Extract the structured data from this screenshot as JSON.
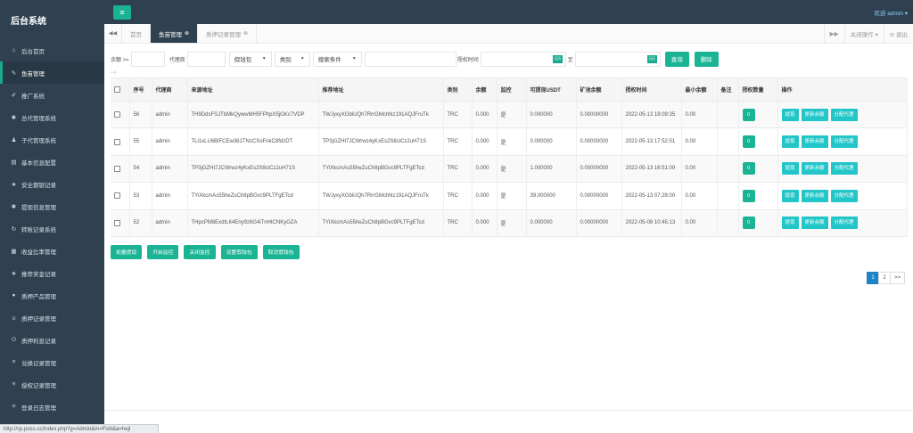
{
  "sidebar": {
    "brand": "后台系统",
    "items": [
      {
        "label": "后台首页",
        "icon": "home-icon",
        "glyph": "⌂"
      },
      {
        "label": "鱼苗管理",
        "icon": "wrench-icon",
        "glyph": "✎",
        "active": true
      },
      {
        "label": "推广系统",
        "icon": "edit-icon",
        "glyph": "✐"
      },
      {
        "label": "总代管理系统",
        "icon": "gear-icon",
        "glyph": "✱"
      },
      {
        "label": "子代管理系统",
        "icon": "users-icon",
        "glyph": "♟"
      },
      {
        "label": "基本信息配置",
        "icon": "document-icon",
        "glyph": "▤"
      },
      {
        "label": "安全期银记录",
        "icon": "star-icon",
        "glyph": "★"
      },
      {
        "label": "提现信息管理",
        "icon": "gear-icon",
        "glyph": "✱"
      },
      {
        "label": "转账记录系统",
        "icon": "refresh-icon",
        "glyph": "↻"
      },
      {
        "label": "收益比率管理",
        "icon": "calendar-icon",
        "glyph": "▦"
      },
      {
        "label": "推荐奖金记录",
        "icon": "star-icon",
        "glyph": "★"
      },
      {
        "label": "质押产品管理",
        "icon": "comment-icon",
        "glyph": "●"
      },
      {
        "label": "质押记录管理",
        "icon": "magnet-icon",
        "glyph": "∪"
      },
      {
        "label": "质押利息记录",
        "icon": "power-icon",
        "glyph": "⏻"
      },
      {
        "label": "兑换记录管理",
        "icon": "list-icon",
        "glyph": "≡"
      },
      {
        "label": "授权记录管理",
        "icon": "list-icon",
        "glyph": "≡"
      },
      {
        "label": "登录日志管理",
        "icon": "list-icon",
        "glyph": "≡"
      }
    ]
  },
  "status_url": "http://cp.poss.cc/index.php?g=Admin&m=Fish&a=heji",
  "topbar": {
    "menu_glyph": "≡",
    "welcome": "欢迎 admin ▾"
  },
  "tabs": {
    "left_arrow": "◀◀",
    "items": [
      {
        "label": "首页",
        "active": false,
        "close": ""
      },
      {
        "label": "鱼苗管理",
        "active": true,
        "close": "⊗"
      },
      {
        "label": "质押记录管理",
        "active": false,
        "close": "⊗"
      }
    ],
    "right_arrow": "▶▶",
    "close_ops": "关闭操作 ▾",
    "logout": "⊖ 退出"
  },
  "filters": {
    "balance_label": "余额 >=",
    "agent_label": "代理商",
    "wallet_select": "假钱包",
    "type_select": "类别",
    "search_select": "搜索条件",
    "auth_time_label": "授权时间",
    "to_label": "至",
    "date_icon": "日历",
    "query_button": "查询",
    "delete_button": "删除"
  },
  "comment_marker": "-->",
  "table": {
    "headers": [
      "",
      "序号",
      "代理商",
      "来源地址",
      "推荐地址",
      "类别",
      "余额",
      "监控",
      "可提现USDT",
      "矿池余额",
      "授权时间",
      "最小余额",
      "备注",
      "授权数量",
      "操作"
    ],
    "rows": [
      {
        "id": "56",
        "agent": "admin",
        "source": "TH9DdsFSJTbMkQywwMH5FPhpX5jGKc7VDP",
        "referrer": "TWJyxyXGbiUQh7RrrGMchNz191AQJFruTk",
        "type": "TRC",
        "balance": "0.000",
        "monitor": "是",
        "withdrawable": "0.000000",
        "pool": "0.00000000",
        "auth_time": "2022-05-13 18:09:35",
        "min_balance": "0.00",
        "note": "",
        "auth_count": "0"
      },
      {
        "id": "55",
        "agent": "admin",
        "source": "TLi1xLU6BiFCEw361TNzCSoFnkC8fdzDT",
        "referrer": "TP3jGZHt7JCWrwz4yKxEs2S8ciCz2uH71S",
        "type": "TRC",
        "balance": "0.000",
        "monitor": "是",
        "withdrawable": "0.000000",
        "pool": "0.00000000",
        "auth_time": "2022-05-13 17:52:51",
        "min_balance": "0.00",
        "note": "",
        "auth_count": "0"
      },
      {
        "id": "54",
        "agent": "admin",
        "source": "TP3jGZHt7JCWrwz4yKxEs2S8ciCz2uH71S",
        "referrer": "TYiXkcmAs55heZuCh8pBGvc9PLTFgETcd",
        "type": "TRC",
        "balance": "0.000",
        "monitor": "是",
        "withdrawable": "1.000000",
        "pool": "0.00000000",
        "auth_time": "2022-05-13 16:51:00",
        "min_balance": "0.00",
        "note": "",
        "auth_count": "0"
      },
      {
        "id": "53",
        "agent": "admin",
        "source": "TYiXkcmAs55heZuCh8pBGvc9PLTFgETcd",
        "referrer": "TWJyxyXGbiUQh7RrrGMchNz191AQJFruTk",
        "type": "TRC",
        "balance": "0.000",
        "monitor": "是",
        "withdrawable": "39.000000",
        "pool": "0.00000000",
        "auth_time": "2022-05-13 07:28:00",
        "min_balance": "0.00",
        "note": "",
        "auth_count": "0"
      },
      {
        "id": "52",
        "agent": "admin",
        "source": "THpcPM8ExdtL64Eny9z6G4iTnHtCNKyGZA",
        "referrer": "TYiXkcmAs55heZuCh8pBGvc9PLTFgETcd",
        "type": "TRC",
        "balance": "0.000",
        "monitor": "是",
        "withdrawable": "0.000000",
        "pool": "0.00000000",
        "auth_time": "2022-05-08 10:45:13",
        "min_balance": "0.00",
        "note": "",
        "auth_count": "0"
      }
    ],
    "actions": {
      "withdraw": "提现",
      "update_balance": "更新余额",
      "assign_agent": "分配代理"
    }
  },
  "bulk": {
    "batch_withdraw": "批量提现",
    "enable_monitor": "开启监控",
    "disable_monitor": "关闭监控",
    "set_fake_wallet": "设置假钱包",
    "cancel_fake_wallet": "取消假钱包"
  },
  "pagination": {
    "pages": [
      "1",
      "2"
    ],
    "next": ">>",
    "current": "1"
  },
  "colors": {
    "sidebar": "#2f4050",
    "primary": "#1ab394",
    "info": "#23c6c8",
    "page_active": "#1c84c6"
  }
}
